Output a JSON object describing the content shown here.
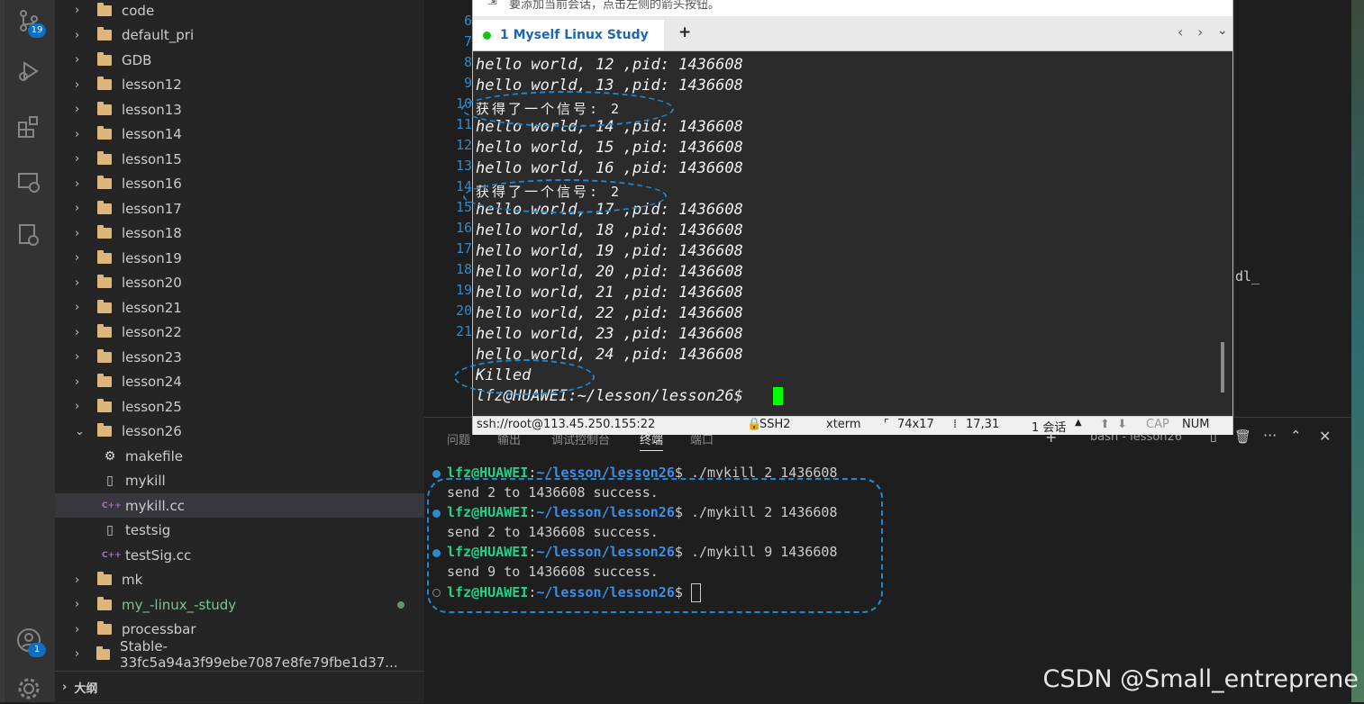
{
  "activity_bar": {
    "source_control_badge": "19",
    "account_badge": "1"
  },
  "explorer": {
    "folders_top": [
      "code",
      "default_pri",
      "GDB",
      "lesson12",
      "lesson13",
      "lesson14",
      "lesson15",
      "lesson16",
      "lesson17",
      "lesson18",
      "lesson19",
      "lesson20",
      "lesson21",
      "lesson22",
      "lesson23",
      "lesson24",
      "lesson25"
    ],
    "open_folder": "lesson26",
    "children": [
      "makefile",
      "mykill",
      "mykill.cc",
      "testsig",
      "testSig.cc"
    ],
    "folders_bottom": [
      "mk",
      "my_-linux_-study",
      "processbar",
      "Stable-33fc5a94a3f99ebe7087e8fe79fbe1d37..."
    ],
    "outline_label": "大纲"
  },
  "editor": {
    "line_numbers": [
      "6",
      "7",
      "8",
      "9",
      "10",
      "11",
      "12",
      "13",
      "14",
      "15",
      "16",
      "17",
      "18",
      "19",
      "20",
      "21"
    ],
    "right_fragment": "dl_"
  },
  "panel": {
    "tabs": [
      "问题",
      "输出",
      "调试控制台",
      "终端",
      "端口"
    ],
    "terminal_name": "bash - lesson26",
    "prompt_user": "lfz@HUAWEI",
    "prompt_path": "~/lesson/lesson26",
    "lines": [
      {
        "cmd": "./mykill 2 1436608",
        "out": "send 2 to 1436608 success."
      },
      {
        "cmd": "./mykill 2 1436608",
        "out": "send 2 to 1436608 success."
      },
      {
        "cmd": "./mykill 9 1436608",
        "out": "send 9 to 1436608 success."
      }
    ]
  },
  "xshell": {
    "tip": "要添加当前会话，点击左侧的箭头按钮。",
    "tab_title": "1 Myself Linux Study",
    "add_tab": "+",
    "terminal_lines": [
      "hello world, 12 ,pid: 1436608",
      "hello world, 13 ,pid: 1436608",
      "获得了一个信号: 2",
      "hello world, 14 ,pid: 1436608",
      "hello world, 15 ,pid: 1436608",
      "hello world, 16 ,pid: 1436608",
      "获得了一个信号: 2",
      "hello world, 17 ,pid: 1436608",
      "hello world, 18 ,pid: 1436608",
      "hello world, 19 ,pid: 1436608",
      "hello world, 20 ,pid: 1436608",
      "hello world, 21 ,pid: 1436608",
      "hello world, 22 ,pid: 1436608",
      "hello world, 23 ,pid: 1436608",
      "hello world, 24 ,pid: 1436608",
      "Killed",
      "lfz@HUAWEI:~/lesson/lesson26$ "
    ],
    "status": {
      "connection": "ssh://root@113.45.250.155:22",
      "protocol": "SSH2",
      "term": "xterm",
      "size": "74x17",
      "cursor": "17,31",
      "sessions": "1 会话",
      "cap": "CAP",
      "num": "NUM"
    }
  },
  "watermark": "CSDN @Small_entreprene",
  "colors": {
    "prompt_green": "#23d18b",
    "path_blue": "#3b8eea",
    "ellipse": "#1b8ad6",
    "cursor": "#00ff00"
  }
}
